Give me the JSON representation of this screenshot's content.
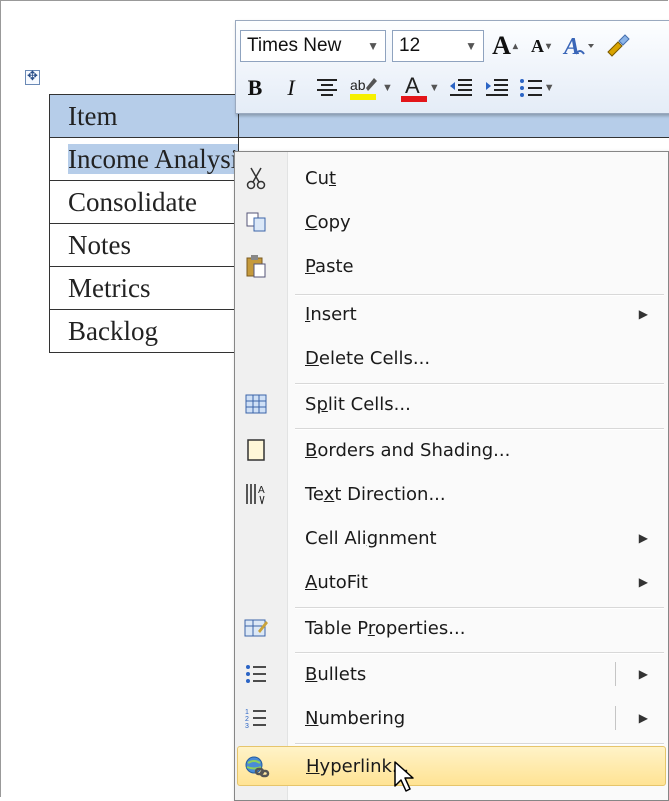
{
  "table": {
    "rows": [
      "Item",
      "Income Anal",
      "Consolidate",
      "Notes",
      "Metrics",
      "Backlog"
    ],
    "selected_text_suffix": "ysi"
  },
  "mini_toolbar": {
    "font_name": "Times New",
    "font_size": "12",
    "grow_font": "A",
    "shrink_font": "A",
    "bold": "B",
    "italic": "I",
    "font_color_letter": "A",
    "highlight_text": "ab"
  },
  "context_menu": {
    "items": [
      {
        "pre": "Cu",
        "u": "t",
        "post": "",
        "icon": "scissors-icon"
      },
      {
        "pre": "",
        "u": "C",
        "post": "opy",
        "icon": "copy-icon"
      },
      {
        "pre": "",
        "u": "P",
        "post": "aste",
        "icon": "paste-icon"
      },
      {
        "pre": "",
        "u": "I",
        "post": "nsert",
        "icon": ""
      },
      {
        "pre": "",
        "u": "D",
        "post": "elete Cells...",
        "icon": ""
      },
      {
        "pre": "S",
        "u": "p",
        "post": "lit Cells...",
        "icon": "split-cells-icon"
      },
      {
        "pre": "",
        "u": "B",
        "post": "orders and Shading...",
        "icon": "borders-icon"
      },
      {
        "pre": "Te",
        "u": "x",
        "post": "t Direction...",
        "icon": "text-direction-icon"
      },
      {
        "pre": "Cell Ali",
        "u": "g",
        "post": "nment",
        "icon": ""
      },
      {
        "pre": "",
        "u": "A",
        "post": "utoFit",
        "icon": ""
      },
      {
        "pre": "Table P",
        "u": "r",
        "post": "operties...",
        "icon": "table-properties-icon"
      },
      {
        "pre": "",
        "u": "B",
        "post": "ullets",
        "icon": "bullets-icon"
      },
      {
        "pre": "",
        "u": "N",
        "post": "umbering",
        "icon": "numbering-icon"
      },
      {
        "pre": "",
        "u": "H",
        "post": "yperlink...",
        "icon": "hyperlink-icon"
      }
    ]
  },
  "colors": {
    "selection": "#b6cde9",
    "menu_hover": "#ffe394",
    "font_color_bar": "#e3151a",
    "highlight_bar": "#f6f000"
  }
}
